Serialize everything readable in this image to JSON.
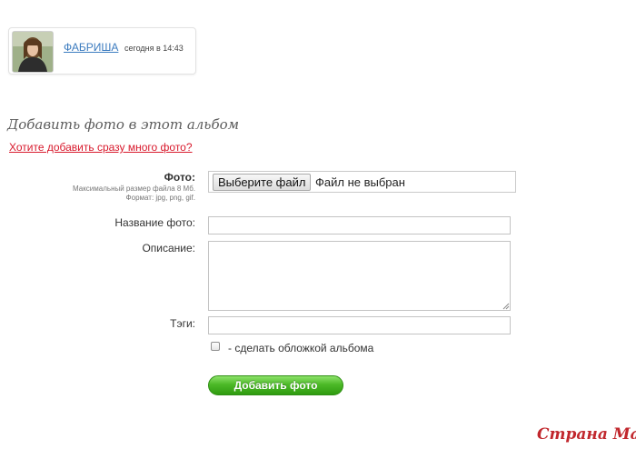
{
  "author": {
    "name": "ФАБРИША",
    "time": "сегодня в 14:43"
  },
  "upload_form": {
    "title": "Добавить фото в этот альбом",
    "bulk_link": "Хотите добавить сразу много фото?",
    "photo_label": "Фото:",
    "photo_hint_size": "Максимальный размер файла 8 Мб.",
    "photo_hint_format": "Формат: jpg, png, gif.",
    "file_button_label": "Выберите файл",
    "file_status": "Файл не выбран",
    "name_label": "Название фото:",
    "name_value": "",
    "description_label": "Описание:",
    "description_value": "",
    "tags_label": "Тэги:",
    "tags_value": "",
    "cover_checkbox_checked": false,
    "cover_checkbox_label": "- сделать обложкой альбома",
    "submit_label": "Добавить фото"
  },
  "watermark": "Страна Мам",
  "colors": {
    "link": "#3b7bbf",
    "bulk_link": "#d8192c",
    "submit_green": "#4cb927",
    "watermark": "#c1272d"
  },
  "icons": {
    "avatar": "user-photo",
    "resize_grip": "resize-grip-icon"
  }
}
